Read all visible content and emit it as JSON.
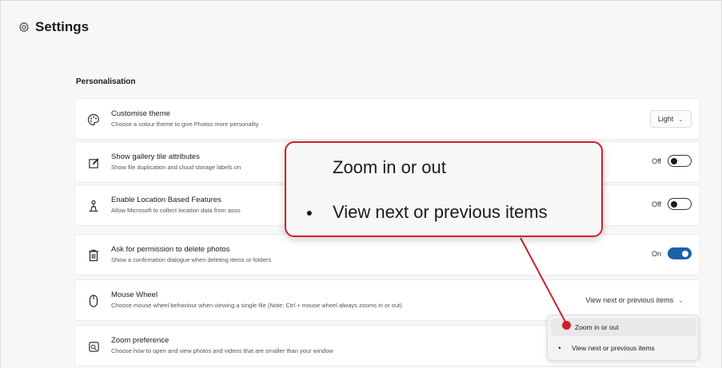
{
  "header": {
    "title": "Settings",
    "icon": "gear-icon"
  },
  "section": {
    "label": "Personalisation"
  },
  "settings": [
    {
      "icon": "palette-icon",
      "title": "Customise theme",
      "description": "Choose a colour theme to give Photos more personality",
      "control": "dropdown",
      "value": "Light"
    },
    {
      "icon": "edit-tile-icon",
      "title": "Show gallery tile attributes",
      "description": "Show file duplication and cloud storage labels on",
      "control": "toggle",
      "value": "Off",
      "on": false
    },
    {
      "icon": "location-person-icon",
      "title": "Enable Location Based Features",
      "description": "Allow Microsoft to collect location data from asso",
      "control": "toggle",
      "value": "Off",
      "on": false
    },
    {
      "icon": "trash-icon",
      "title": "Ask for permission to delete photos",
      "description": "Show a confirmation dialogue when deleting items or folders",
      "control": "toggle",
      "value": "On",
      "on": true
    },
    {
      "icon": "mouse-icon",
      "title": "Mouse Wheel",
      "description": "Choose mouse wheel behaviour when viewing a single file (Note: Ctrl + mouse wheel always zooms in or out)",
      "control": "dropdown",
      "value": "View next or previous items"
    },
    {
      "icon": "zoom-image-icon",
      "title": "Zoom preference",
      "description": "Choose how to open and view photos and videos that are smaller than your window"
    }
  ],
  "mouse_wheel_menu": {
    "options": [
      "Zoom in or out",
      "View next or previous items"
    ],
    "selected": "View next or previous items",
    "highlighted": "Zoom in or out"
  },
  "callout": {
    "options": [
      "Zoom in or out",
      "View next or previous items"
    ],
    "selected": "View next or previous items"
  },
  "colors": {
    "accent": "#1d5fa8",
    "annotation": "#d0202c"
  }
}
